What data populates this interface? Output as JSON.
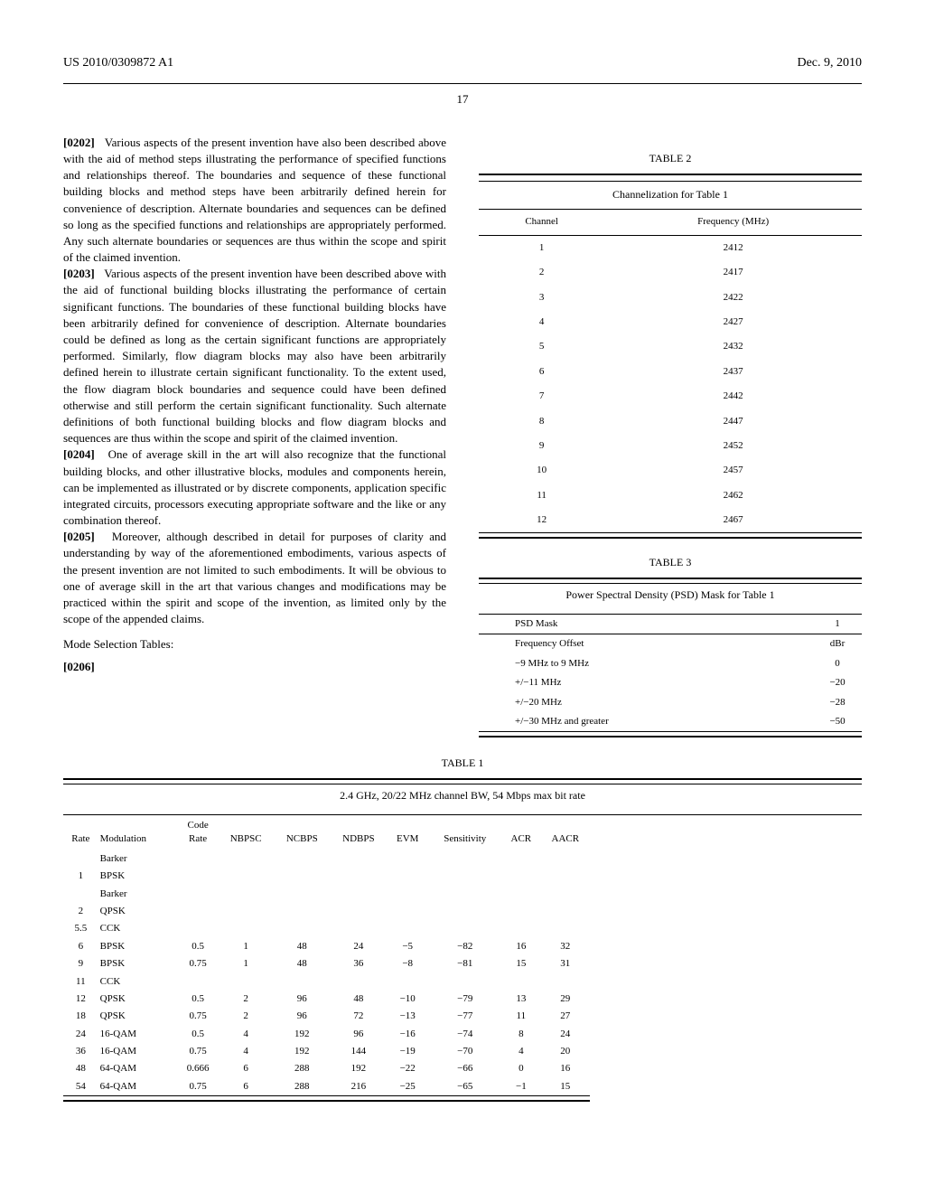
{
  "header": {
    "pub": "US 2010/0309872 A1",
    "date": "Dec. 9, 2010"
  },
  "page": "17",
  "left": {
    "p1_num": "[0202]",
    "p1_text": "Various aspects of the present invention have also been described above with the aid of method steps illustrating the performance of specified functions and relationships thereof. The boundaries and sequence of these functional building blocks and method steps have been arbitrarily defined herein for convenience of description. Alternate boundaries and sequences can be defined so long as the specified functions and relationships are appropriately performed. Any such alternate boundaries or sequences are thus within the scope and spirit of the claimed invention.",
    "p2_num": "[0203]",
    "p2_text": "Various aspects of the present invention have been described above with the aid of functional building blocks illustrating the performance of certain significant functions. The boundaries of these functional building blocks have been arbitrarily defined for convenience of description. Alternate boundaries could be defined as long as the certain significant functions are appropriately performed. Similarly, flow diagram blocks may also have been arbitrarily defined herein to illustrate certain significant functionality. To the extent used, the flow diagram block boundaries and sequence could have been defined otherwise and still perform the certain significant functionality. Such alternate definitions of both functional building blocks and flow diagram blocks and sequences are thus within the scope and spirit of the claimed invention.",
    "p3_num": "[0204]",
    "p3_text": "One of average skill in the art will also recognize that the functional building blocks, and other illustrative blocks, modules and components herein, can be implemented as illustrated or by discrete components, application specific integrated circuits, processors executing appropriate software and the like or any combination thereof.",
    "p4_num": "[0205]",
    "p4_text": "Moreover, although described in detail for purposes of clarity and understanding by way of the aforementioned embodiments, various aspects of the present invention are not limited to such embodiments. It will be obvious to one of average skill in the art that various changes and modifications may be practiced within the spirit and scope of the invention, as limited only by the scope of the appended claims.",
    "mode_label": "Mode Selection Tables:",
    "p5_num": "[0206]"
  },
  "table1": {
    "label": "TABLE 1",
    "caption": "2.4 GHz, 20/22 MHz channel BW, 54 Mbps max bit rate",
    "headers": [
      "Rate",
      "Modulation",
      "Code Rate",
      "NBPSC",
      "NCBPS",
      "NDBPS",
      "EVM",
      "Sensitivity",
      "ACR",
      "AACR"
    ],
    "rows": [
      [
        "1",
        "Barker BPSK",
        "",
        "",
        "",
        "",
        "",
        "",
        "",
        ""
      ],
      [
        "2",
        "Barker QPSK",
        "",
        "",
        "",
        "",
        "",
        "",
        "",
        ""
      ],
      [
        "5.5",
        "CCK",
        "",
        "",
        "",
        "",
        "",
        "",
        "",
        ""
      ],
      [
        "6",
        "BPSK",
        "0.5",
        "1",
        "48",
        "24",
        "−5",
        "−82",
        "16",
        "32"
      ],
      [
        "9",
        "BPSK",
        "0.75",
        "1",
        "48",
        "36",
        "−8",
        "−81",
        "15",
        "31"
      ],
      [
        "11",
        "CCK",
        "",
        "",
        "",
        "",
        "",
        "",
        "",
        ""
      ],
      [
        "12",
        "QPSK",
        "0.5",
        "2",
        "96",
        "48",
        "−10",
        "−79",
        "13",
        "29"
      ],
      [
        "18",
        "QPSK",
        "0.75",
        "2",
        "96",
        "72",
        "−13",
        "−77",
        "11",
        "27"
      ],
      [
        "24",
        "16-QAM",
        "0.5",
        "4",
        "192",
        "96",
        "−16",
        "−74",
        "8",
        "24"
      ],
      [
        "36",
        "16-QAM",
        "0.75",
        "4",
        "192",
        "144",
        "−19",
        "−70",
        "4",
        "20"
      ],
      [
        "48",
        "64-QAM",
        "0.666",
        "6",
        "288",
        "192",
        "−22",
        "−66",
        "0",
        "16"
      ],
      [
        "54",
        "64-QAM",
        "0.75",
        "6",
        "288",
        "216",
        "−25",
        "−65",
        "−1",
        "15"
      ]
    ]
  },
  "table2": {
    "label": "TABLE 2",
    "caption": "Channelization for Table 1",
    "headers": [
      "Channel",
      "Frequency (MHz)"
    ],
    "rows": [
      [
        "1",
        "2412"
      ],
      [
        "2",
        "2417"
      ],
      [
        "3",
        "2422"
      ],
      [
        "4",
        "2427"
      ],
      [
        "5",
        "2432"
      ],
      [
        "6",
        "2437"
      ],
      [
        "7",
        "2442"
      ],
      [
        "8",
        "2447"
      ],
      [
        "9",
        "2452"
      ],
      [
        "10",
        "2457"
      ],
      [
        "11",
        "2462"
      ],
      [
        "12",
        "2467"
      ]
    ]
  },
  "table3": {
    "label": "TABLE 3",
    "caption": "Power Spectral Density (PSD) Mask for Table 1",
    "h1": "PSD Mask",
    "h2": "1",
    "rows": [
      [
        "Frequency Offset",
        "dBr"
      ],
      [
        "−9 MHz to 9 MHz",
        "0"
      ],
      [
        "+/−11 MHz",
        "−20"
      ],
      [
        "+/−20 MHz",
        "−28"
      ],
      [
        "+/−30 MHz and greater",
        "−50"
      ]
    ]
  },
  "chart_data": [
    {
      "type": "table",
      "title": "TABLE 1 — 2.4 GHz, 20/22 MHz channel BW, 54 Mbps max bit rate",
      "columns": [
        "Rate",
        "Modulation",
        "Code Rate",
        "NBPSC",
        "NCBPS",
        "NDBPS",
        "EVM",
        "Sensitivity",
        "ACR",
        "AACR"
      ],
      "data": [
        [
          1,
          "Barker BPSK",
          null,
          null,
          null,
          null,
          null,
          null,
          null,
          null
        ],
        [
          2,
          "Barker QPSK",
          null,
          null,
          null,
          null,
          null,
          null,
          null,
          null
        ],
        [
          5.5,
          "CCK",
          null,
          null,
          null,
          null,
          null,
          null,
          null,
          null
        ],
        [
          6,
          "BPSK",
          0.5,
          1,
          48,
          24,
          -5,
          -82,
          16,
          32
        ],
        [
          9,
          "BPSK",
          0.75,
          1,
          48,
          36,
          -8,
          -81,
          15,
          31
        ],
        [
          11,
          "CCK",
          null,
          null,
          null,
          null,
          null,
          null,
          null,
          null
        ],
        [
          12,
          "QPSK",
          0.5,
          2,
          96,
          48,
          -10,
          -79,
          13,
          29
        ],
        [
          18,
          "QPSK",
          0.75,
          2,
          96,
          72,
          -13,
          -77,
          11,
          27
        ],
        [
          24,
          "16-QAM",
          0.5,
          4,
          192,
          96,
          -16,
          -74,
          8,
          24
        ],
        [
          36,
          "16-QAM",
          0.75,
          4,
          192,
          144,
          -19,
          -70,
          4,
          20
        ],
        [
          48,
          "64-QAM",
          0.666,
          6,
          288,
          192,
          -22,
          -66,
          0,
          16
        ],
        [
          54,
          "64-QAM",
          0.75,
          6,
          288,
          216,
          -25,
          -65,
          -1,
          15
        ]
      ]
    },
    {
      "type": "table",
      "title": "TABLE 2 — Channelization for Table 1",
      "columns": [
        "Channel",
        "Frequency (MHz)"
      ],
      "data": [
        [
          1,
          2412
        ],
        [
          2,
          2417
        ],
        [
          3,
          2422
        ],
        [
          4,
          2427
        ],
        [
          5,
          2432
        ],
        [
          6,
          2437
        ],
        [
          7,
          2442
        ],
        [
          8,
          2447
        ],
        [
          9,
          2452
        ],
        [
          10,
          2457
        ],
        [
          11,
          2462
        ],
        [
          12,
          2467
        ]
      ]
    },
    {
      "type": "table",
      "title": "TABLE 3 — PSD Mask for Table 1",
      "columns": [
        "Frequency Offset",
        "dBr"
      ],
      "data": [
        [
          "−9 MHz to 9 MHz",
          0
        ],
        [
          "+/−11 MHz",
          -20
        ],
        [
          "+/−20 MHz",
          -28
        ],
        [
          "+/−30 MHz and greater",
          -50
        ]
      ]
    }
  ]
}
